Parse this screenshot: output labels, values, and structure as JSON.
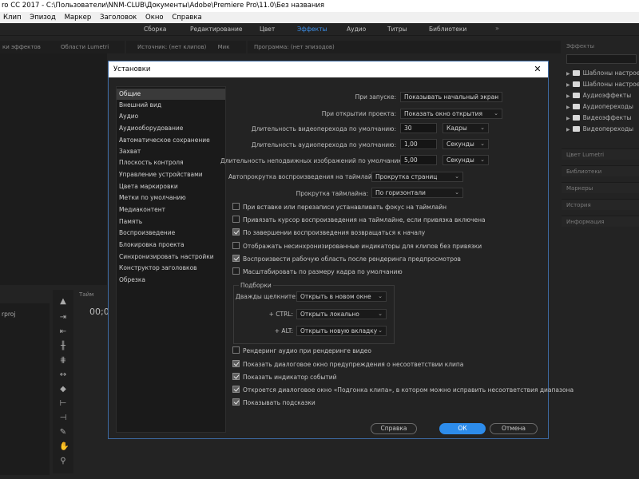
{
  "window": {
    "title": "ro CC 2017 - C:\\Пользователи\\NNM-CLUB\\Документы\\Adobe\\Premiere Pro\\11.0\\Без названия"
  },
  "menu": [
    "Клип",
    "Эпизод",
    "Маркер",
    "Заголовок",
    "Окно",
    "Справка"
  ],
  "workspaces": {
    "items": [
      "Сборка",
      "Редактирование",
      "Цвет",
      "Эффекты",
      "Аудио",
      "Титры",
      "Библиотеки"
    ],
    "active": "Эффекты",
    "more": "»"
  },
  "panels": {
    "effect_controls": "ки эффектов",
    "lumetri_scopes": "Области Lumetri",
    "source": "Источник: (нет клипов)",
    "mix": "Мик",
    "program": "Программа: (нет эпизодов)",
    "project_file": "rproj",
    "timeline_tab": "Тайм",
    "timecode": "00;0"
  },
  "effects_panel": {
    "title": "Эффекты",
    "items": [
      {
        "label": "Шаблоны настроек",
        "expandable": true,
        "icon": "preset-icon"
      },
      {
        "label": "Шаблоны настроек",
        "expandable": true,
        "icon": "preset-icon"
      },
      {
        "label": "Аудиоэффекты",
        "expandable": true,
        "icon": "folder-icon"
      },
      {
        "label": "Аудиопереходы",
        "expandable": true,
        "icon": "folder-icon"
      },
      {
        "label": "Видеоэффекты",
        "expandable": true,
        "icon": "folder-icon"
      },
      {
        "label": "Видеопереходы",
        "expandable": true,
        "icon": "folder-icon"
      }
    ],
    "collapsed_panels": [
      "Цвет Lumetri",
      "Библиотеки",
      "Маркеры",
      "История",
      "Информация"
    ]
  },
  "dialog": {
    "title": "Установки",
    "close": "✕",
    "categories": [
      "Общие",
      "Внешний вид",
      "Аудио",
      "Аудиооборудование",
      "Автоматическое сохранение",
      "Захват",
      "Плоскость контроля",
      "Управление устройствами",
      "Цвета маркировки",
      "Метки по умолчанию",
      "Медиаконтент",
      "Память",
      "Воспроизведение",
      "Блокировка проекта",
      "Синхронизировать настройки",
      "Конструктор заголовков",
      "Обрезка"
    ],
    "selected_category": "Общие",
    "settings": {
      "on_startup": {
        "label": "При запуске:",
        "value": "Показывать начальный экран"
      },
      "on_open_project": {
        "label": "При открытии проекта:",
        "value": "Показать окно открытия"
      },
      "video_transition": {
        "label": "Длительность видеоперехода по умолчанию:",
        "value": "30",
        "unit": "Кадры"
      },
      "audio_transition": {
        "label": "Длительность аудиоперехода по умолчанию:",
        "value": "1,00",
        "unit": "Секунды"
      },
      "still_image": {
        "label": "Длительность неподвижных изображений по умолчанию:",
        "value": "5,00",
        "unit": "Секунды"
      },
      "timeline_autoscroll": {
        "label": "Автопрокрутка воспроизведения на таймлайне:",
        "value": "Прокрутка страниц"
      },
      "timeline_scroll": {
        "label": "Прокрутка таймлайна:",
        "value": "По горизонтали"
      }
    },
    "checkboxes_top": [
      {
        "label": "При вставке или перезаписи устанавливать фокус на таймлайн",
        "checked": false
      },
      {
        "label": "Привязать курсор воспроизведения на таймлайне, если привязка включена",
        "checked": false
      },
      {
        "label": "По завершении воспроизведения возвращаться к началу",
        "checked": true
      },
      {
        "label": "Отображать несинхронизированные индикаторы для клипов без привязки",
        "checked": false
      },
      {
        "label": "Воспроизвести рабочую область после рендеринга предпросмотров",
        "checked": true
      },
      {
        "label": "Масштабировать по размеру кадра по умолчанию",
        "checked": false
      }
    ],
    "bins": {
      "title": "Подборки",
      "double_click": {
        "label": "Дважды щелкните:",
        "value": "Открыть в новом окне"
      },
      "ctrl": {
        "label": "+ CTRL:",
        "value": "Открыть локально"
      },
      "alt": {
        "label": "+ ALT:",
        "value": "Открыть новую вкладку"
      }
    },
    "checkboxes_bottom": [
      {
        "label": "Рендеринг аудио при рендеринге видео",
        "checked": false
      },
      {
        "label": "Показать диалоговое окно предупреждения о несоответствии клипа",
        "checked": true
      },
      {
        "label": "Показать индикатор событий",
        "checked": true
      },
      {
        "label": "Откроется диалоговое окно «Подгонка клипа», в котором можно исправить несоответствия диапазона",
        "checked": true
      },
      {
        "label": "Показывать подсказки",
        "checked": true
      }
    ],
    "buttons": {
      "help": "Справка",
      "ok": "ОК",
      "cancel": "Отмена"
    }
  }
}
